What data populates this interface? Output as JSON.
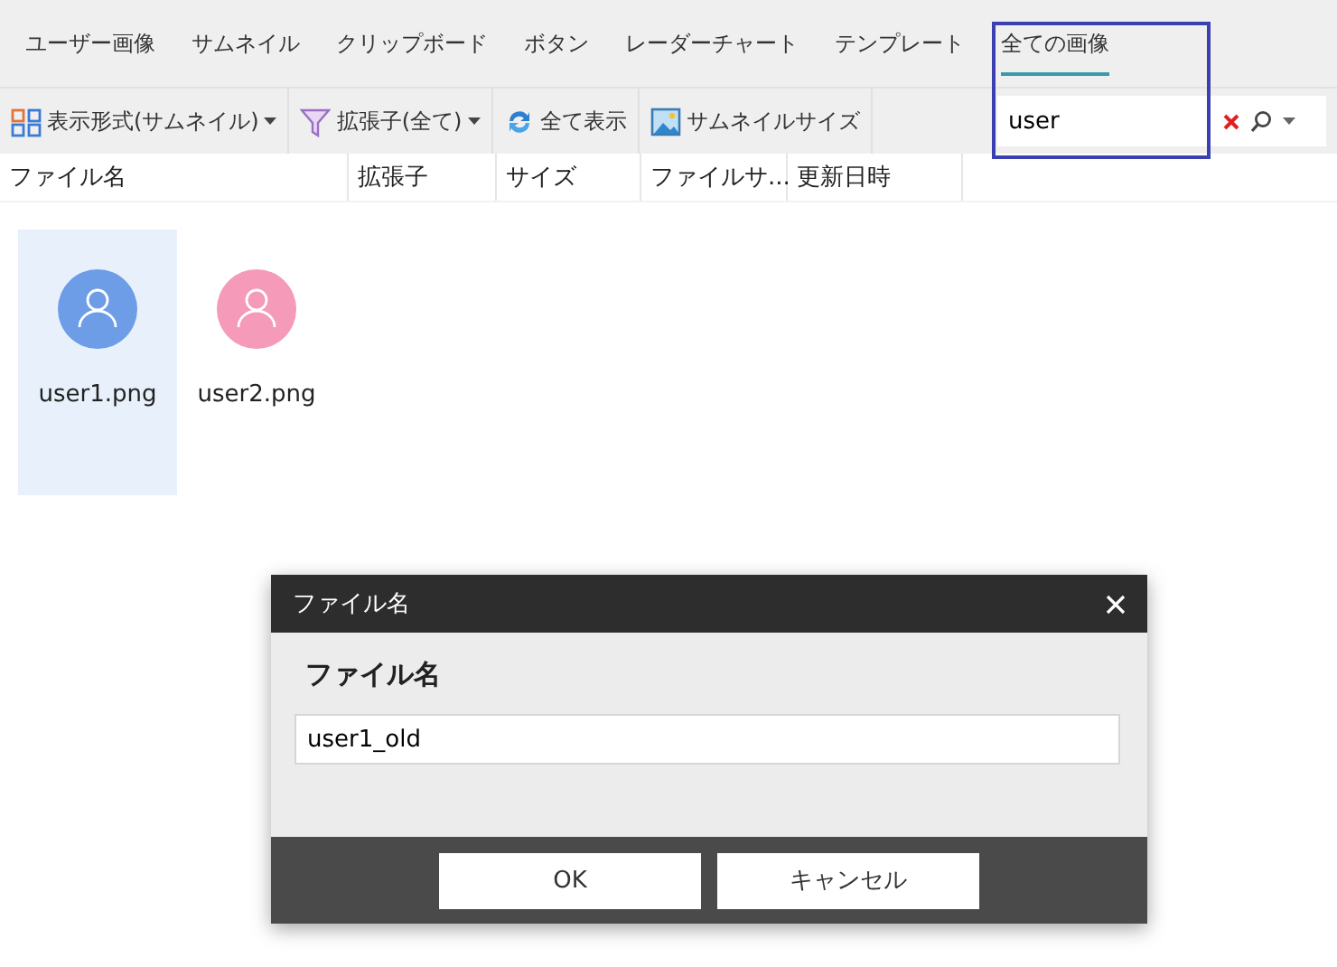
{
  "tabs": [
    {
      "label": "ユーザー画像",
      "selected": false
    },
    {
      "label": "サムネイル",
      "selected": false
    },
    {
      "label": "クリップボード",
      "selected": false
    },
    {
      "label": "ボタン",
      "selected": false
    },
    {
      "label": "レーダーチャート",
      "selected": false
    },
    {
      "label": "テンプレート",
      "selected": false
    },
    {
      "label": "全ての画像",
      "selected": true
    }
  ],
  "toolbar": [
    {
      "kind": "grid",
      "label": "表示形式(サムネイル)",
      "dropdown": true
    },
    {
      "kind": "filter",
      "label": "拡張子(全て)",
      "dropdown": true
    },
    {
      "kind": "refresh",
      "label": "全て表示",
      "dropdown": false
    },
    {
      "kind": "image",
      "label": "サムネイルサイズ",
      "dropdown": false
    }
  ],
  "search": {
    "value": "user"
  },
  "columns": [
    "ファイル名",
    "拡張子",
    "サイズ",
    "ファイルサ...",
    "更新日時"
  ],
  "files": [
    {
      "name": "user1.png",
      "color": "#6e9de8",
      "selected": true
    },
    {
      "name": "user2.png",
      "color": "#f59ab8",
      "selected": false
    }
  ],
  "dialog": {
    "title": "ファイル名",
    "label": "ファイル名",
    "value": "user1_old",
    "buttons": [
      "OK",
      "キャンセル"
    ]
  }
}
